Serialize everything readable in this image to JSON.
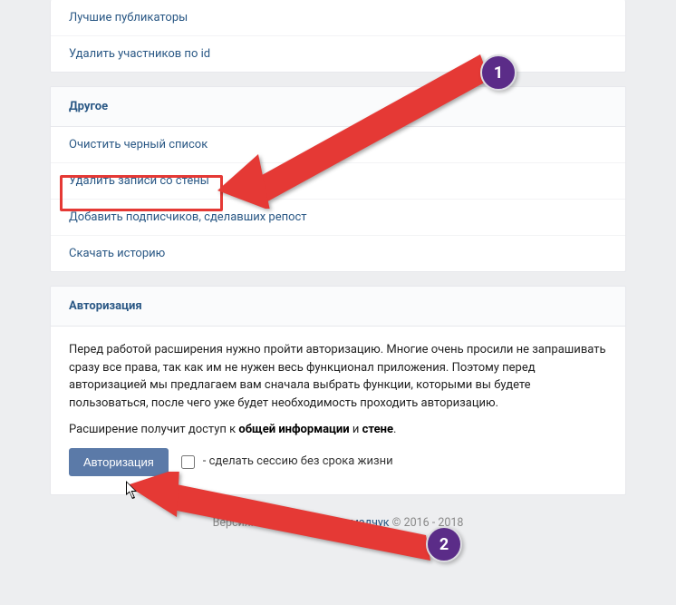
{
  "top_panel": {
    "items": [
      {
        "label": "Лучшие публикаторы"
      },
      {
        "label": "Удалить участников по id"
      }
    ]
  },
  "other_panel": {
    "title": "Другое",
    "items": [
      {
        "label": "Очистить черный список"
      },
      {
        "label": "Удалить записи со стены"
      },
      {
        "label": "Добавить подписчиков, сделавших репост"
      },
      {
        "label": "Скачать историю"
      }
    ]
  },
  "auth_panel": {
    "title": "Авторизация",
    "paragraph": "Перед работой расширения нужно пройти авторизацию. Многие очень просили не запрашивать сразу все права, так как им не нужен весь функционал приложения. Поэтому перед авторизацией мы предлагаем вам сначала выбрать функции, которыми вы будете пользоваться, после чего уже будет необходимость проходить авторизацию.",
    "access_prefix": "Расширение получит доступ к ",
    "access_bold1": "общей информации",
    "access_mid": " и ",
    "access_bold2": "стене",
    "access_suffix": ".",
    "button": "Авторизация",
    "checkbox_label": " - сделать сессию без срока жизни"
  },
  "footer": {
    "version_label": "Версия: 2.73.0",
    "sep": " · ",
    "author": "Павел Громадчук",
    "copyright": " © 2016 - 2018"
  },
  "annotations": {
    "badge1": "1",
    "badge2": "2"
  }
}
